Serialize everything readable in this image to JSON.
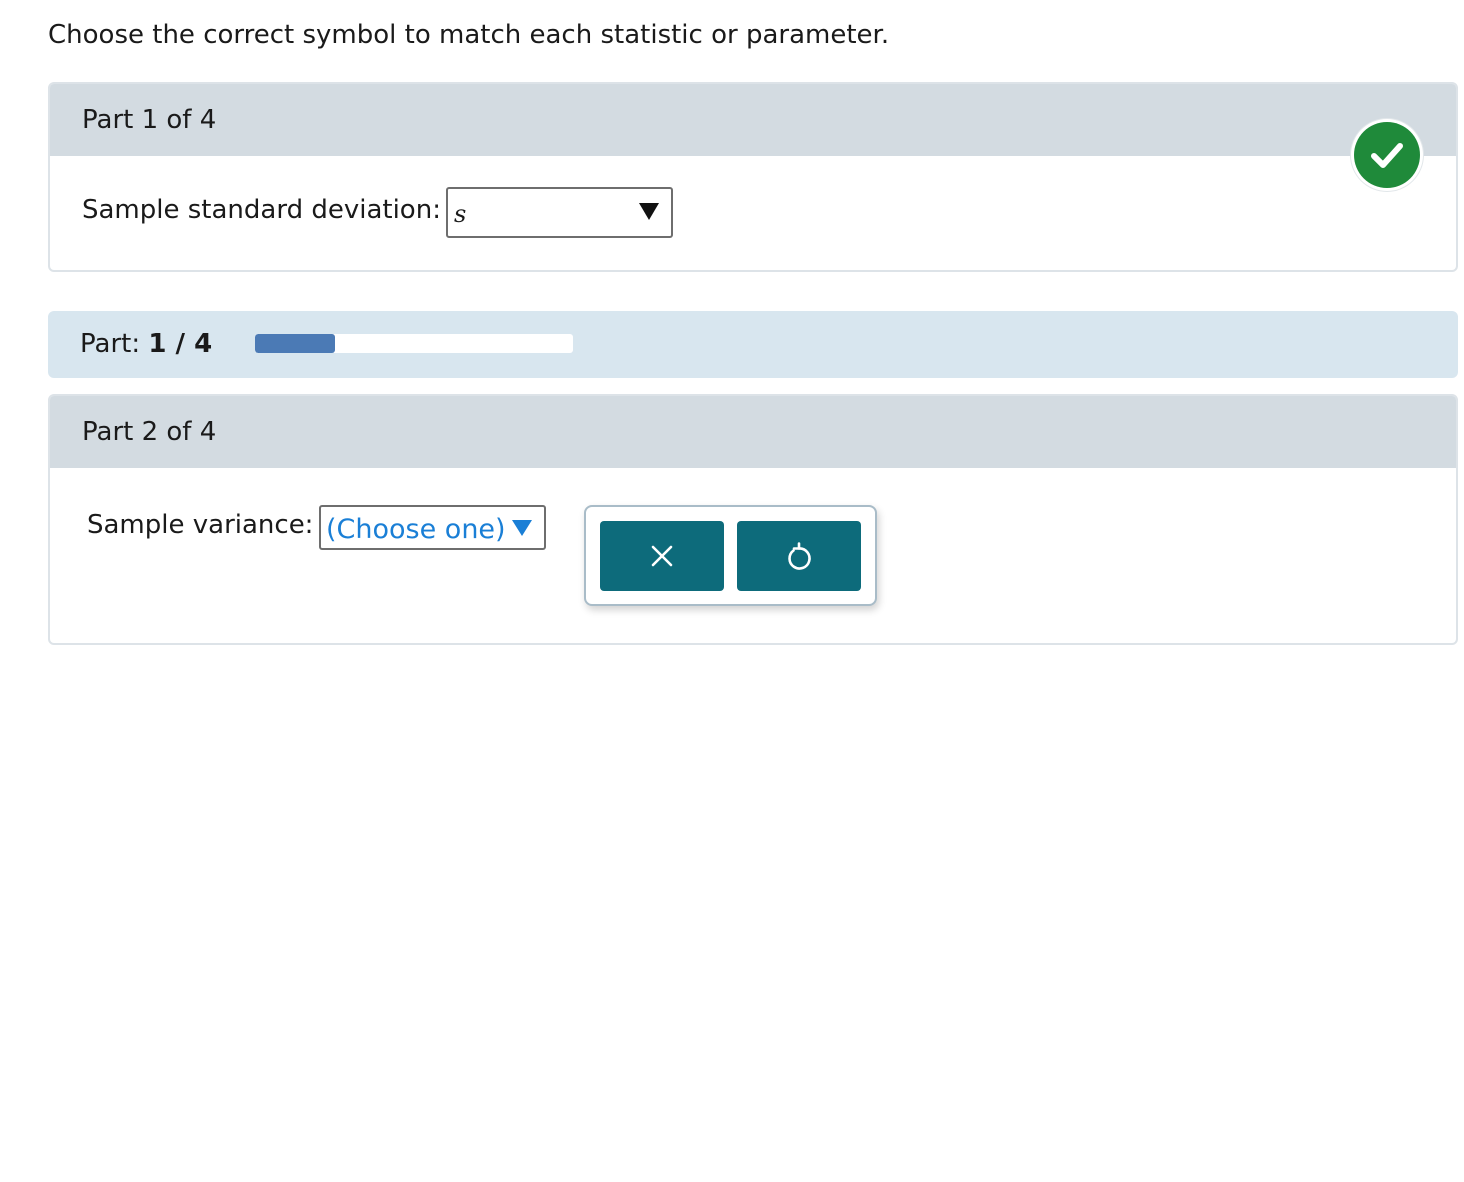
{
  "instructions": "Choose the correct symbol to match each statistic or parameter.",
  "parts": [
    {
      "title": "Part 1 of 4",
      "field_label": "Sample standard deviation:",
      "selected_value": "s",
      "status": "correct"
    },
    {
      "title": "Part 2 of 4",
      "field_label": "Sample variance:",
      "selected_value": "(Choose one)"
    }
  ],
  "progress": {
    "label": "Part:",
    "current": "1",
    "separator": "/",
    "total": "4",
    "fraction": 0.25
  },
  "actions": {
    "clear_icon": "close-icon",
    "undo_icon": "undo-icon"
  },
  "colors": {
    "correct_badge": "#1f8a3a",
    "progress_fill": "#4b7ab5",
    "action_button": "#0d6b7b",
    "dropdown_placeholder": "#1a7fd6"
  }
}
